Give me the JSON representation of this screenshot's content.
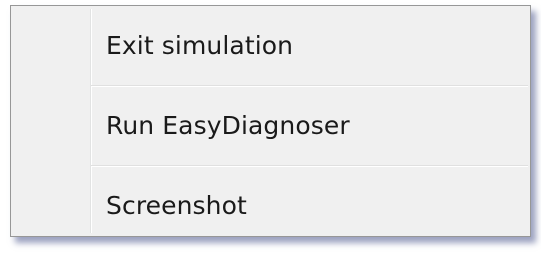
{
  "context_menu": {
    "items": [
      {
        "label": "Exit simulation"
      },
      {
        "label": "Run EasyDiagnoser"
      },
      {
        "label": "Screenshot"
      }
    ]
  }
}
